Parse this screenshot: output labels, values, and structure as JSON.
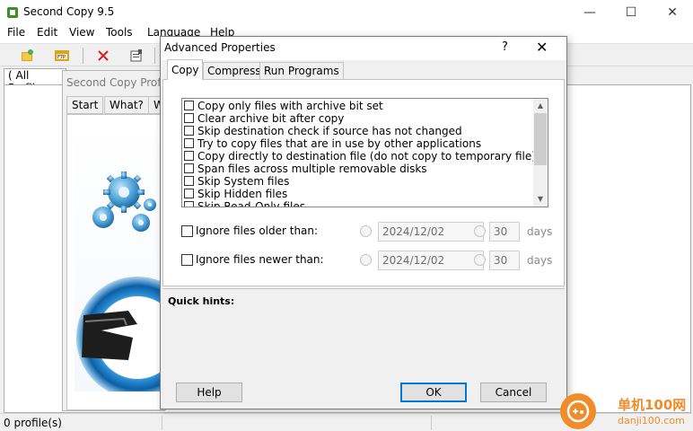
{
  "main_window": {
    "title": "Second Copy 9.5",
    "menu": [
      "File",
      "Edit",
      "View",
      "Tools",
      "Language",
      "Help"
    ],
    "profiles_tab": "(   All Profiles",
    "status": "0 profile(s)"
  },
  "wizard": {
    "title": "Second Copy Profile Wizard",
    "tabs": [
      "Start",
      "What?",
      "W"
    ]
  },
  "dialog": {
    "title": "Advanced Properties",
    "help_glyph": "?",
    "tabs": [
      "Copy",
      "Compress",
      "Run Programs"
    ],
    "active_tab": "Copy",
    "options": [
      "Copy only files with archive bit set",
      "Clear archive bit after copy",
      "Skip destination check if source has not changed",
      "Try to copy files that are in use by other applications",
      "Copy directly to destination file (do not copy to temporary file)",
      "Span files across multiple removable disks",
      "Skip System files",
      "Skip Hidden files",
      "Skip Read-Only files"
    ],
    "filters": [
      {
        "label": "Ignore files older than:",
        "date": "2024/12/02",
        "days_value": "30",
        "days_label": "days"
      },
      {
        "label": "Ignore files newer than:",
        "date": "2024/12/02",
        "days_value": "30",
        "days_label": "days"
      }
    ],
    "hints_label": "Quick hints:",
    "buttons": {
      "help": "Help",
      "ok": "OK",
      "cancel": "Cancel"
    }
  },
  "watermark": {
    "line1": "单机100网",
    "line2": "danji100.com"
  },
  "colors": {
    "accent": "#0078d7",
    "watermark": "#f08c2a",
    "delete_icon": "#e02020"
  },
  "icons": [
    "app-icon",
    "new-profile-icon",
    "ftp-icon",
    "delete-icon",
    "properties-icon"
  ]
}
